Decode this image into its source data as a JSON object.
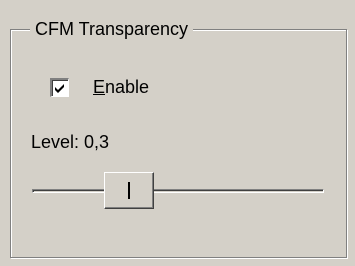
{
  "group": {
    "title": "CFM Transparency"
  },
  "enable_checkbox": {
    "label_rest": "nable",
    "label_accel": "E",
    "checked": true,
    "icon": "checkmark-icon"
  },
  "level": {
    "label": "Level: 0,3",
    "value": 0.3
  }
}
